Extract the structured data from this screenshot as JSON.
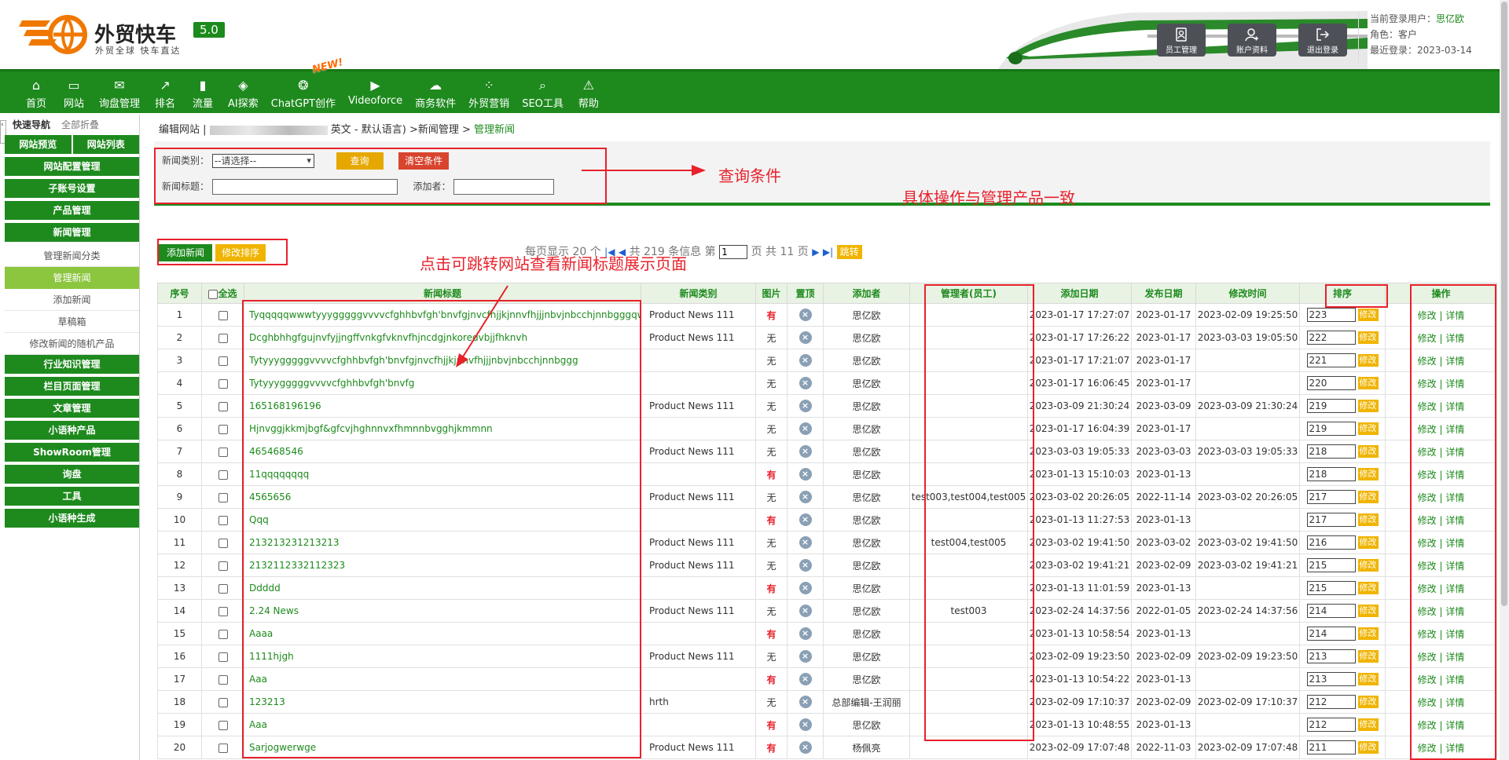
{
  "header": {
    "logo_title": "外贸快车",
    "logo_sub": "外贸全球 快车直达",
    "version": "5.0",
    "buttons": [
      {
        "label": "员工管理",
        "icon": "staff-icon"
      },
      {
        "label": "账户资料",
        "icon": "account-icon"
      },
      {
        "label": "退出登录",
        "icon": "logout-icon"
      }
    ],
    "user_label": "当前登录用户：",
    "user_name": "思亿欧",
    "role": "角色：客户",
    "last_login": "最近登录：2023-03-14"
  },
  "nav": [
    {
      "label": "首页",
      "icon": "⌂"
    },
    {
      "label": "网站",
      "icon": "▭"
    },
    {
      "label": "询盘管理",
      "icon": "✉"
    },
    {
      "label": "排名",
      "icon": "↗"
    },
    {
      "label": "流量",
      "icon": "▮"
    },
    {
      "label": "AI探索",
      "icon": "◈"
    },
    {
      "label": "ChatGPT创作",
      "icon": "❂",
      "badge": "NEW!"
    },
    {
      "label": "Videoforce",
      "icon": "▶"
    },
    {
      "label": "商务软件",
      "icon": "☁"
    },
    {
      "label": "外贸营销",
      "icon": "⁘"
    },
    {
      "label": "SEO工具",
      "icon": "⌕"
    },
    {
      "label": "帮助",
      "icon": "⚠"
    }
  ],
  "sidebar": {
    "head_nav": "快速导航",
    "head_fold": "全部折叠",
    "tabs": [
      "网站预览",
      "网站列表"
    ],
    "items": [
      {
        "label": "网站配置管理",
        "type": "group"
      },
      {
        "label": "子账号设置",
        "type": "group"
      },
      {
        "label": "产品管理",
        "type": "group"
      },
      {
        "label": "新闻管理",
        "type": "group"
      },
      {
        "label": "管理新闻分类",
        "type": "sub"
      },
      {
        "label": "管理新闻",
        "type": "sub-active"
      },
      {
        "label": "添加新闻",
        "type": "sub"
      },
      {
        "label": "草稿箱",
        "type": "sub"
      },
      {
        "label": "修改新闻的随机产品",
        "type": "sub"
      },
      {
        "label": "行业知识管理",
        "type": "group"
      },
      {
        "label": "栏目页面管理",
        "type": "group"
      },
      {
        "label": "文章管理",
        "type": "group"
      },
      {
        "label": "小语种产品",
        "type": "group"
      },
      {
        "label": "ShowRoom管理",
        "type": "group"
      },
      {
        "label": "询盘",
        "type": "group"
      },
      {
        "label": "工具",
        "type": "group"
      },
      {
        "label": "小语种生成",
        "type": "group"
      }
    ]
  },
  "breadcrumb": {
    "prefix": "编辑网站 |",
    "mid": "英文 - 默认语言) >新闻管理 > ",
    "current": "管理新闻"
  },
  "query": {
    "category_label": "新闻类别：",
    "category_value": "--请选择--",
    "search_btn": "查询",
    "clear_btn": "清空条件",
    "title_label": "新闻标题：",
    "adder_label": "添加者："
  },
  "annotations": {
    "query": "查询条件",
    "same_ops": "具体操作与管理产品一致",
    "title_jump": "点击可跳转网站查看新闻标题展示页面"
  },
  "toolbar": {
    "add_btn": "添加新闻",
    "sort_btn": "修改排序"
  },
  "pager": {
    "per_page": "每页显示 20 个",
    "total": "共 219 条信息 第",
    "page": "1",
    "pages": "页 共 11 页",
    "jump": "跳转"
  },
  "table": {
    "headers": [
      "序号",
      "全选",
      "新闻标题",
      "新闻类别",
      "图片",
      "置顶",
      "添加者",
      "管理者(员工)",
      "添加日期",
      "发布日期",
      "修改时间",
      "排序",
      "操作"
    ],
    "sort_btn": "修改",
    "op_edit": "修改",
    "op_sep": "|",
    "op_detail": "详情",
    "rows": [
      {
        "no": "1",
        "title": "Tyqqqqqwwwtyyygggggvvvvcfghhbvfgh'bnvfgjnvcfhjjkjnnvfhjjjnbvjnbcchjnnbgggqwwwweeeeer",
        "cat": "Product News 111",
        "pic": "有",
        "adder": "思亿欧",
        "mgr": "",
        "added": "2023-01-17 17:27:07",
        "pub": "2023-01-17",
        "mod": "2023-02-09 19:25:50",
        "sort": "223"
      },
      {
        "no": "2",
        "title": "Dcghbhhgfgujnvfyjjngffvnkgfvknvfhjncdgjnkoredvbjjfhknvh",
        "cat": "Product News 111",
        "pic": "无",
        "adder": "思亿欧",
        "mgr": "",
        "added": "2023-01-17 17:26:22",
        "pub": "2023-01-17",
        "mod": "2023-03-03 19:05:50",
        "sort": "222"
      },
      {
        "no": "3",
        "title": "Tytyyygggggvvvvcfghhbvfgh'bnvfgjnvcfhjjkjnnvfhjjjnbvjnbcchjnnbggg",
        "cat": "",
        "pic": "无",
        "adder": "思亿欧",
        "mgr": "",
        "added": "2023-01-17 17:21:07",
        "pub": "2023-01-17",
        "mod": "",
        "sort": "221"
      },
      {
        "no": "4",
        "title": "Tytyyygggggvvvvcfghhbvfgh'bnvfg",
        "cat": "",
        "pic": "无",
        "adder": "思亿欧",
        "mgr": "",
        "added": "2023-01-17 16:06:45",
        "pub": "2023-01-17",
        "mod": "",
        "sort": "220"
      },
      {
        "no": "5",
        "title": "165168196196",
        "cat": "Product News 111",
        "pic": "无",
        "adder": "思亿欧",
        "mgr": "",
        "added": "2023-03-09 21:30:24",
        "pub": "2023-03-09",
        "mod": "2023-03-09 21:30:24",
        "sort": "219"
      },
      {
        "no": "6",
        "title": "Hjnvggjkkmjbgf&gfcvjhghnnvxfhmnnbvgghjkmmnn",
        "cat": "",
        "pic": "无",
        "adder": "思亿欧",
        "mgr": "",
        "added": "2023-01-17 16:04:39",
        "pub": "2023-01-17",
        "mod": "",
        "sort": "219"
      },
      {
        "no": "7",
        "title": "465468546",
        "cat": "Product News 111",
        "pic": "无",
        "adder": "思亿欧",
        "mgr": "",
        "added": "2023-03-03 19:05:33",
        "pub": "2023-03-03",
        "mod": "2023-03-03 19:05:33",
        "sort": "218"
      },
      {
        "no": "8",
        "title": "11qqqqqqqq",
        "cat": "",
        "pic": "有",
        "adder": "思亿欧",
        "mgr": "",
        "added": "2023-01-13 15:10:03",
        "pub": "2023-01-13",
        "mod": "",
        "sort": "218"
      },
      {
        "no": "9",
        "title": "4565656",
        "cat": "Product News 111",
        "pic": "无",
        "adder": "思亿欧",
        "mgr": "test003,test004,test005",
        "added": "2023-03-02 20:26:05",
        "pub": "2022-11-14",
        "mod": "2023-03-02 20:26:05",
        "sort": "217"
      },
      {
        "no": "10",
        "title": "Qqq",
        "cat": "",
        "pic": "有",
        "adder": "思亿欧",
        "mgr": "",
        "added": "2023-01-13 11:27:53",
        "pub": "2023-01-13",
        "mod": "",
        "sort": "217"
      },
      {
        "no": "11",
        "title": "213213231213213",
        "cat": "Product News 111",
        "pic": "无",
        "adder": "思亿欧",
        "mgr": "test004,test005",
        "added": "2023-03-02 19:41:50",
        "pub": "2023-03-02",
        "mod": "2023-03-02 19:41:50",
        "sort": "216"
      },
      {
        "no": "12",
        "title": "2132112332112323",
        "cat": "Product News 111",
        "pic": "无",
        "adder": "思亿欧",
        "mgr": "",
        "added": "2023-03-02 19:41:21",
        "pub": "2023-02-09",
        "mod": "2023-03-02 19:41:21",
        "sort": "215"
      },
      {
        "no": "13",
        "title": "Ddddd",
        "cat": "",
        "pic": "有",
        "adder": "思亿欧",
        "mgr": "",
        "added": "2023-01-13 11:01:59",
        "pub": "2023-01-13",
        "mod": "",
        "sort": "215"
      },
      {
        "no": "14",
        "title": "2.24 News",
        "cat": "Product News 111",
        "pic": "无",
        "adder": "思亿欧",
        "mgr": "test003",
        "added": "2023-02-24 14:37:56",
        "pub": "2022-01-05",
        "mod": "2023-02-24 14:37:56",
        "sort": "214"
      },
      {
        "no": "15",
        "title": "Aaaa",
        "cat": "",
        "pic": "有",
        "adder": "思亿欧",
        "mgr": "",
        "added": "2023-01-13 10:58:54",
        "pub": "2023-01-13",
        "mod": "",
        "sort": "214"
      },
      {
        "no": "16",
        "title": "1111hjgh",
        "cat": "Product News 111",
        "pic": "无",
        "adder": "思亿欧",
        "mgr": "",
        "added": "2023-02-09 19:23:50",
        "pub": "2023-02-09",
        "mod": "2023-02-09 19:23:50",
        "sort": "213"
      },
      {
        "no": "17",
        "title": "Aaa",
        "cat": "",
        "pic": "有",
        "adder": "思亿欧",
        "mgr": "",
        "added": "2023-01-13 10:54:22",
        "pub": "2023-01-13",
        "mod": "",
        "sort": "213"
      },
      {
        "no": "18",
        "title": "123213",
        "cat": "hrth",
        "pic": "无",
        "adder": "总部编辑-王润丽",
        "mgr": "",
        "added": "2023-02-09 17:10:37",
        "pub": "2023-02-09",
        "mod": "2023-02-09 17:10:37",
        "sort": "212"
      },
      {
        "no": "19",
        "title": "Aaa",
        "cat": "",
        "pic": "有",
        "adder": "思亿欧",
        "mgr": "",
        "added": "2023-01-13 10:48:55",
        "pub": "2023-01-13",
        "mod": "",
        "sort": "212"
      },
      {
        "no": "20",
        "title": "Sarjogwerwge",
        "cat": "Product News 111",
        "pic": "有",
        "adder": "杨佩亮",
        "mgr": "",
        "added": "2023-02-09 17:07:48",
        "pub": "2022-11-03",
        "mod": "2023-02-09 17:07:48",
        "sort": "211"
      }
    ]
  }
}
